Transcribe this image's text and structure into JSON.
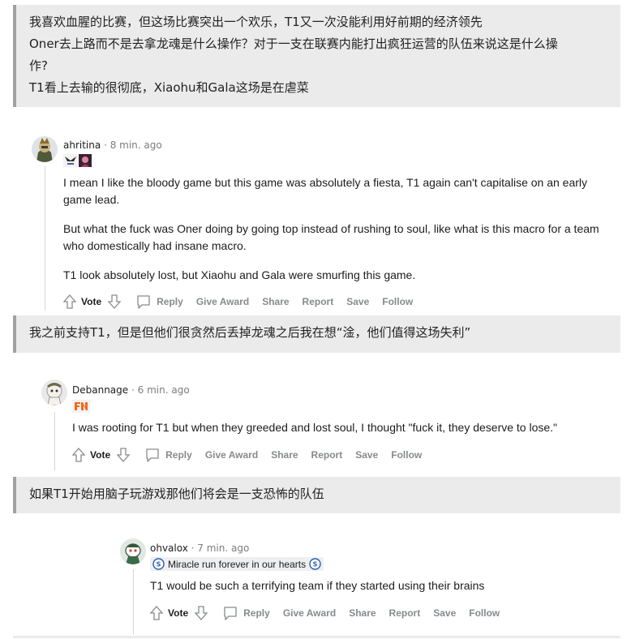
{
  "translations": [
    {
      "lines": [
        "我喜欢血腥的比赛，但这场比赛突出一个欢乐，T1又一次没能利用好前期的经济领先",
        "Oner去上路而不是去拿龙魂是什么操作？对于一支在联赛内能打出疯狂运营的队伍来说这是什么操",
        "作?",
        "T1看上去输的很彻底，Xiaohu和Gala这场是在虐菜"
      ]
    },
    {
      "lines": [
        "我之前支持T1，但是但他们很贪然后丢掉龙魂之后我在想“淦，他们值得这场失利”"
      ]
    },
    {
      "lines": [
        "如果T1开始用脑子玩游戏那他们将会是一支恐怖的队伍"
      ]
    }
  ],
  "comments": [
    {
      "username": "ahritina",
      "time": "8 min. ago",
      "flair_icons": [
        "lck-logo-icon",
        "champion-portrait-icon"
      ],
      "paragraphs": [
        "I mean I like the bloody game but this game was absolutely a fiesta, T1 again can't capitalise on an early game lead.",
        "But what the fuck was Oner doing by going top instead of rushing to soul, like what is this macro for a team who domestically had insane macro.",
        "T1 look absolutely lost, but Xiaohu and Gala were smurfing this game."
      ]
    },
    {
      "username": "Debannage",
      "time": "6 min. ago",
      "flair_icons": [
        "fnatic-logo-icon"
      ],
      "paragraphs": [
        "I was rooting for T1 but when they greeded and lost soul, I thought \"fuck it, they deserve to lose.\""
      ]
    },
    {
      "username": "ohvalox",
      "time": "7 min. ago",
      "flair_text": "Miracle run forever in our hearts",
      "flair_icons": [
        "schalke-logo-icon",
        "schalke-logo-icon"
      ],
      "paragraphs": [
        "T1 would be such a terrifying team if they started using their brains"
      ]
    }
  ],
  "actions": {
    "vote": "Vote",
    "reply": "Reply",
    "give_award": "Give Award",
    "share": "Share",
    "report": "Report",
    "save": "Save",
    "follow": "Follow"
  },
  "colors": {
    "translation_bg": "#ebebeb",
    "translation_border": "#a0a0a0",
    "meta_gray": "#7c7c7c",
    "action_gray": "#878a8c",
    "flair_badge_bg": "#edeff1",
    "fnatic_orange": "#f4681c"
  }
}
